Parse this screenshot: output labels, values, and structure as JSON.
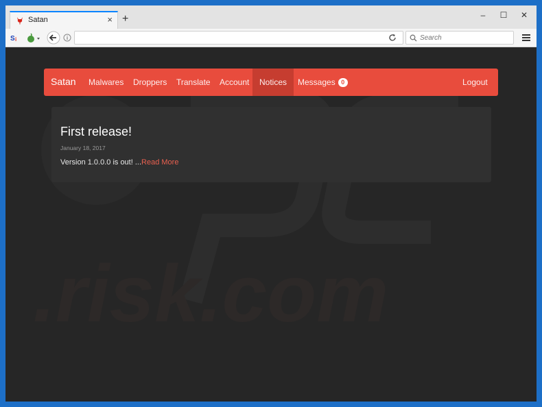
{
  "browser": {
    "tab_title": "Satan",
    "search_placeholder": "Search"
  },
  "navbar": {
    "brand": "Satan",
    "items": [
      {
        "label": "Malwares"
      },
      {
        "label": "Droppers"
      },
      {
        "label": "Translate"
      },
      {
        "label": "Account"
      },
      {
        "label": "Notices"
      },
      {
        "label": "Messages",
        "badge": "0"
      }
    ],
    "logout": "Logout",
    "active_item": "Notices"
  },
  "post": {
    "title": "First release!",
    "date": "January 18, 2017",
    "excerpt": "Version 1.0.0.0 is out! ...",
    "read_more": "Read More"
  },
  "colors": {
    "accent": "#e84c3d",
    "page_bg": "#262626",
    "card_bg": "#303030"
  }
}
